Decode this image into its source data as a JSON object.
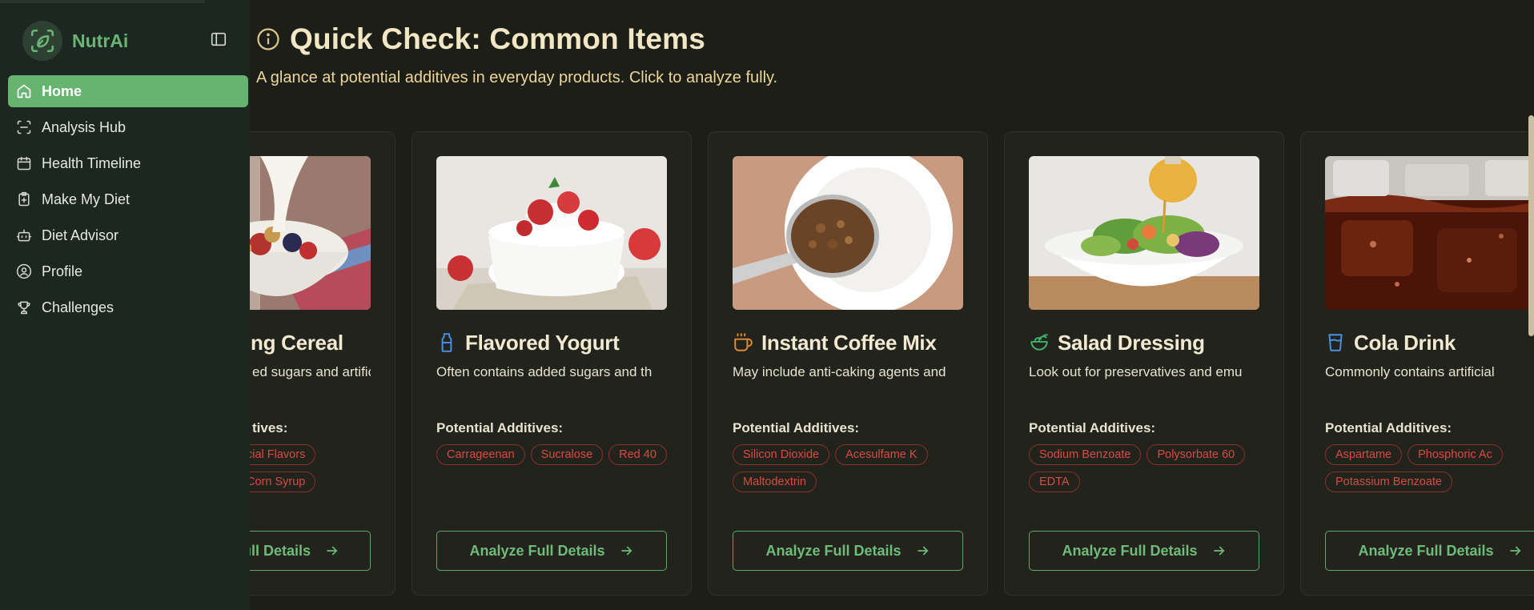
{
  "app": {
    "name": "NutrAi"
  },
  "sidebar": {
    "items": [
      {
        "label": "Home",
        "icon": "home-icon"
      },
      {
        "label": "Analysis Hub",
        "icon": "scan-icon"
      },
      {
        "label": "Health Timeline",
        "icon": "calendar-icon"
      },
      {
        "label": "Make My Diet",
        "icon": "clipboard-icon"
      },
      {
        "label": "Diet Advisor",
        "icon": "bot-icon"
      },
      {
        "label": "Profile",
        "icon": "user-circle-icon"
      },
      {
        "label": "Challenges",
        "icon": "trophy-icon"
      }
    ]
  },
  "header": {
    "title": "Quick Check: Common Items",
    "subtitle": "A glance at potential additives in everyday products. Click to analyze fully."
  },
  "cards": [
    {
      "title": "Breakfast Cereal",
      "title_visible": "ng Cereal",
      "desc_visible": "ed sugars and artific",
      "additives_label": "tives:",
      "tags": [
        "cial Flavors",
        "Corn Syrup"
      ],
      "button": "Full Details"
    },
    {
      "title": "Flavored Yogurt",
      "icon": "milk-bottle-icon",
      "desc": "Often contains added sugars and th",
      "additives_label": "Potential Additives:",
      "tags": [
        "Carrageenan",
        "Sucralose",
        "Red 40"
      ],
      "button": "Analyze Full Details"
    },
    {
      "title": "Instant Coffee Mix",
      "icon": "coffee-cup-icon",
      "desc": "May include anti-caking agents and",
      "additives_label": "Potential Additives:",
      "tags": [
        "Silicon Dioxide",
        "Acesulfame K",
        "Maltodextrin"
      ],
      "button": "Analyze Full Details"
    },
    {
      "title": "Salad Dressing",
      "icon": "salad-bowl-icon",
      "desc": "Look out for preservatives and emu",
      "additives_label": "Potential Additives:",
      "tags": [
        "Sodium Benzoate",
        "Polysorbate 60",
        "EDTA"
      ],
      "button": "Analyze Full Details"
    },
    {
      "title": "Cola Drink",
      "icon": "glass-icon",
      "desc": "Commonly contains artificial",
      "additives_label": "Potential Additives:",
      "tags": [
        "Aspartame",
        "Phosphoric Ac",
        "Potassium Benzoate"
      ],
      "button": "Analyze Full Details"
    }
  ],
  "colors": {
    "accent": "#66b46f",
    "tag_red": "#d94a42",
    "background": "#1d1e18",
    "sidebar": "#1d2721"
  }
}
